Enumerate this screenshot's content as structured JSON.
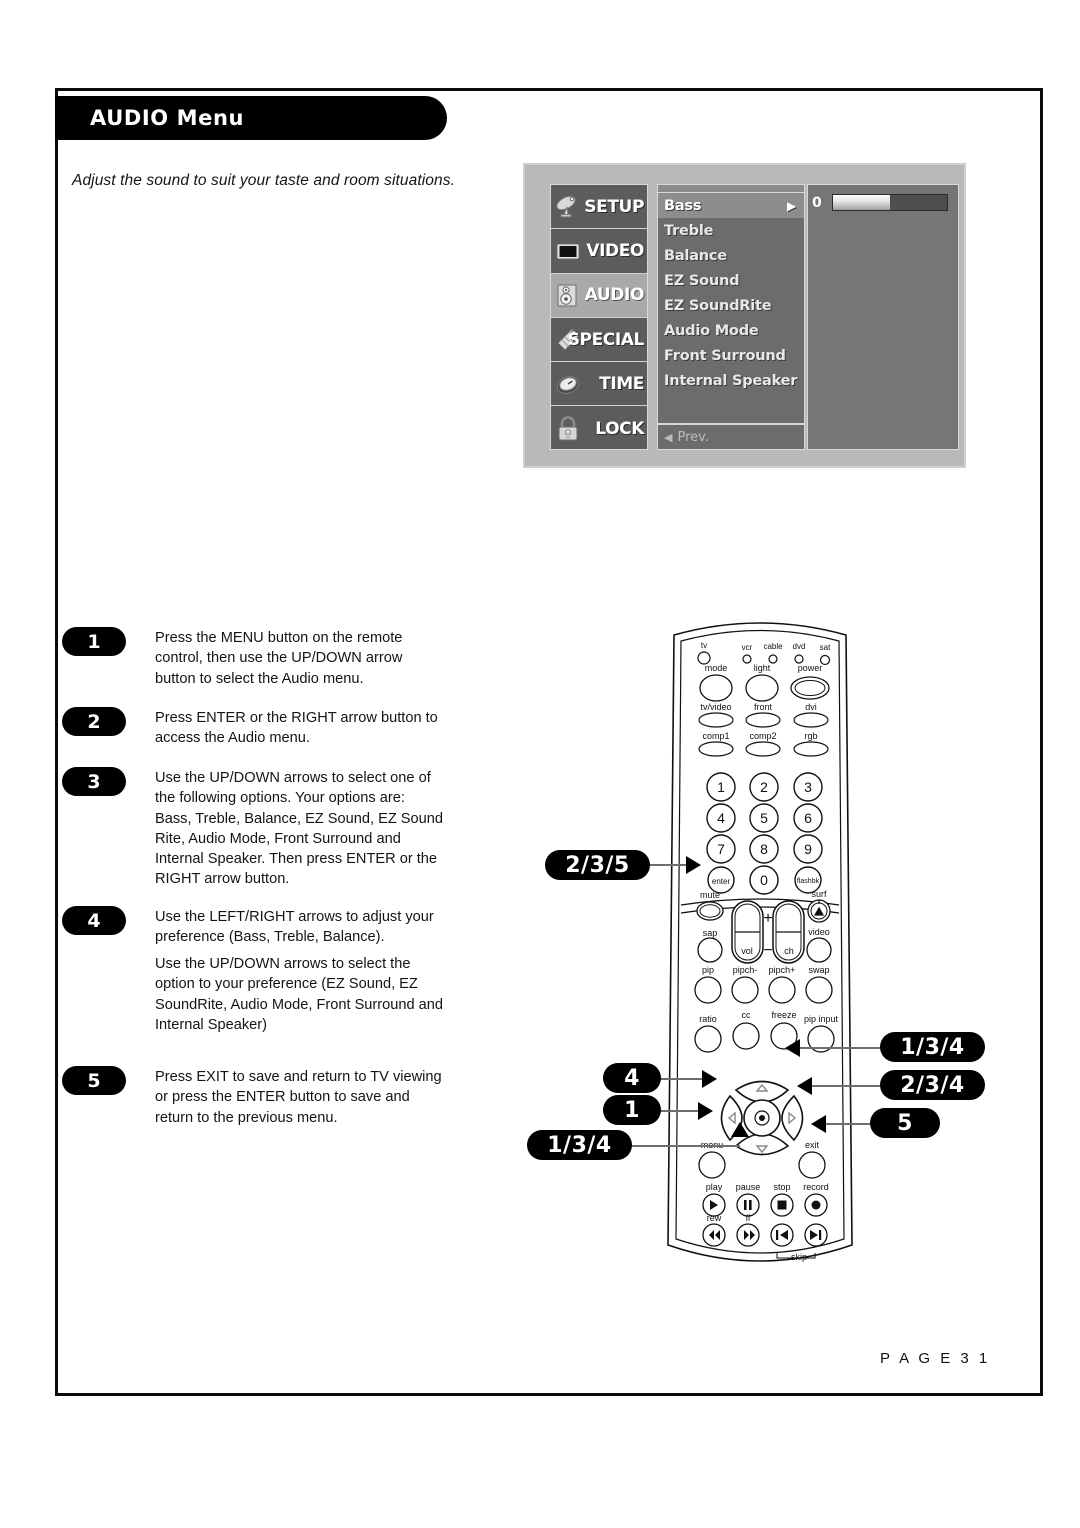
{
  "page": {
    "header_title": "AUDIO Menu",
    "intro": "Adjust the sound to suit your taste and room situations.",
    "footer": "P A G E   3 1"
  },
  "osd": {
    "categories": [
      {
        "label": "SETUP",
        "icon": "satellite-dish-icon",
        "selected": false
      },
      {
        "label": "VIDEO",
        "icon": "tv-screen-icon",
        "selected": false
      },
      {
        "label": "AUDIO",
        "icon": "speaker-icon",
        "selected": true
      },
      {
        "label": "SPECIAL",
        "icon": "tag-icon",
        "selected": false
      },
      {
        "label": "TIME",
        "icon": "clock-icon",
        "selected": false
      },
      {
        "label": "LOCK",
        "icon": "padlock-icon",
        "selected": false
      }
    ],
    "items": [
      {
        "label": "Bass",
        "selected": true
      },
      {
        "label": "Treble",
        "selected": false
      },
      {
        "label": "Balance",
        "selected": false
      },
      {
        "label": "EZ Sound",
        "selected": false
      },
      {
        "label": "EZ SoundRite",
        "selected": false
      },
      {
        "label": "Audio Mode",
        "selected": false
      },
      {
        "label": "Front Surround",
        "selected": false
      },
      {
        "label": "Internal Speaker",
        "selected": false
      }
    ],
    "prev_label": "Prev.",
    "prev_arrow": "◀",
    "item_arrow": "▶",
    "value": "0",
    "slider_percent": 50
  },
  "steps": [
    {
      "num": "1",
      "text": "Press the MENU button on the remote control, then use the UP/DOWN arrow button to select the Audio menu."
    },
    {
      "num": "2",
      "text": "Press ENTER or the RIGHT arrow button to access the Audio menu."
    },
    {
      "num": "3",
      "text": "Use the UP/DOWN arrows to select one of the following options. Your options are: Bass, Treble, Balance, EZ Sound, EZ Sound Rite, Audio Mode, Front Surround and Internal Speaker. Then press ENTER or the RIGHT arrow button."
    },
    {
      "num": "4",
      "text": "Use the LEFT/RIGHT arrows to adjust your preference (Bass, Treble, Balance)."
    },
    {
      "num": "4b",
      "text": "Use the UP/DOWN arrows to select the option to your preference (EZ Sound, EZ SoundRite, Audio Mode, Front Surround and Internal Speaker)"
    },
    {
      "num": "5",
      "text": "Press EXIT to save and return to TV viewing or press the ENTER button to save and return to the previous menu."
    }
  ],
  "callouts": [
    {
      "id": "enter",
      "label": "2/3/5"
    },
    {
      "id": "left",
      "label": "4"
    },
    {
      "id": "menu",
      "label": "1"
    },
    {
      "id": "down",
      "label": "1/3/4"
    },
    {
      "id": "up",
      "label": "1/3/4"
    },
    {
      "id": "right",
      "label": "2/3/4"
    },
    {
      "id": "exit",
      "label": "5"
    }
  ],
  "remote": {
    "mode_leds": [
      "tv",
      "vcr",
      "cable",
      "dvd",
      "sat"
    ],
    "row_mode": [
      "mode",
      "light",
      "power"
    ],
    "row_source1": [
      "tv/video",
      "front",
      "dvi"
    ],
    "row_source2": [
      "comp1",
      "comp2",
      "rgb"
    ],
    "keypad": [
      "1",
      "2",
      "3",
      "4",
      "5",
      "6",
      "7",
      "8",
      "9",
      "enter",
      "0",
      "flashbk"
    ],
    "row_mute": [
      "mute",
      "surf"
    ],
    "row_sap": [
      "sap",
      "video"
    ],
    "rocker_labels": [
      "vol",
      "ch",
      "+",
      "−"
    ],
    "row_pip": [
      "pip",
      "pipch-",
      "pipch+",
      "swap"
    ],
    "row_ratio": [
      "ratio",
      "cc",
      "freeze",
      "pip input"
    ],
    "nav_labels": [
      "menu",
      "exit"
    ],
    "row_transport1": [
      "play",
      "pause",
      "stop",
      "record"
    ],
    "row_transport2": [
      "rew",
      "ff"
    ],
    "skip_label": "skip"
  }
}
